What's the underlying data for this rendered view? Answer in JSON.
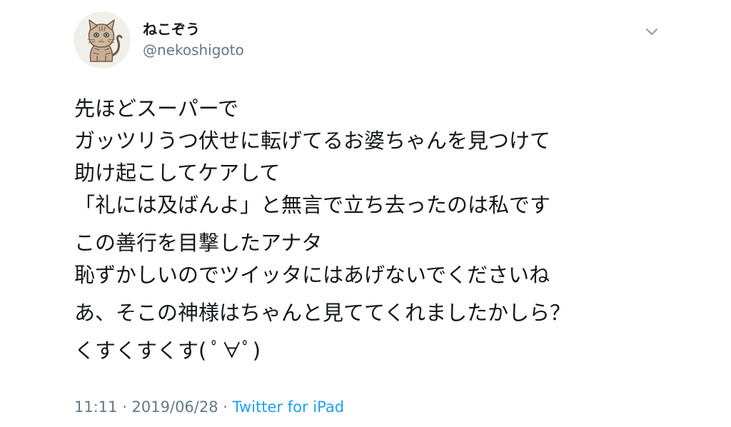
{
  "tweet": {
    "author": {
      "display_name": "ねこぞう",
      "handle": "@nekoshigoto",
      "avatar_icon": "cat-avatar-icon"
    },
    "menu_icon": "chevron-down-icon",
    "paragraphs": [
      [
        "先ほどスーパーで",
        "ガッツリうつ伏せに転げてるお婆ちゃんを見つけて",
        "助け起こしてケアして",
        "「礼には及ばんよ」と無言で立ち去ったのは私です"
      ],
      [
        "この善行を目撃したアナタ",
        "恥ずかしいのでツイッタにはあげないでくださいね"
      ],
      [
        "あ、そこの神様はちゃんと見ててくれましたかしら？"
      ],
      [
        "くすくすくす( ﾟ∀ﾟ)"
      ]
    ],
    "timestamp": "11:11 · 2019/06/28",
    "separator": "·",
    "source": "Twitter for iPad"
  },
  "colors": {
    "text": "#14171a",
    "secondary": "#657786",
    "link": "#1da1f2",
    "avatar_bg": "#f1efe9"
  }
}
